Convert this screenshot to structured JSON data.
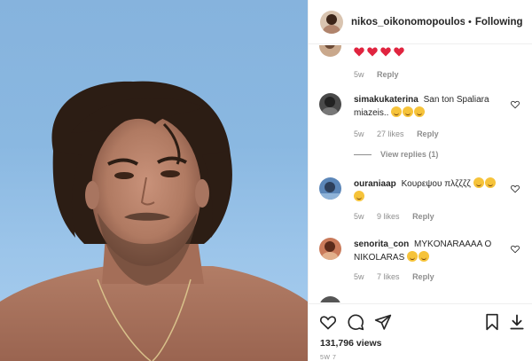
{
  "header": {
    "username": "nikos_oikonomopoulos",
    "separator": "•",
    "follow_status": "Following"
  },
  "comments": [
    {
      "username": "",
      "text": "",
      "hearts": 4,
      "time": "5w",
      "likes": "",
      "reply_label": "Reply"
    },
    {
      "username": "simakukaterina",
      "text": "San ton Spaliara miazeis..",
      "emoji_count": 3,
      "time": "5w",
      "likes": "27 likes",
      "reply_label": "Reply"
    },
    {
      "username": "ouraniaap",
      "text": "Κουρεψου πλζζζζ",
      "emoji_count": 3,
      "time": "5w",
      "likes": "9 likes",
      "reply_label": "Reply"
    },
    {
      "username": "senorita_con",
      "text": "MYKONARAAAA O NIKOLARAS",
      "emoji_count": 2,
      "time": "5w",
      "likes": "7 likes",
      "reply_label": "Reply"
    }
  ],
  "view_replies": "View replies (1)",
  "actions": {
    "views": "131,796 views",
    "posted_ago": "5W 7"
  },
  "colors": {
    "accent_text": "#262626",
    "muted_text": "#8e8e8e",
    "heart_red": "#ed4956",
    "sky": "#8ab8e1"
  },
  "icons": [
    "heart-icon",
    "comment-icon",
    "share-icon",
    "bookmark-icon",
    "download-icon"
  ]
}
